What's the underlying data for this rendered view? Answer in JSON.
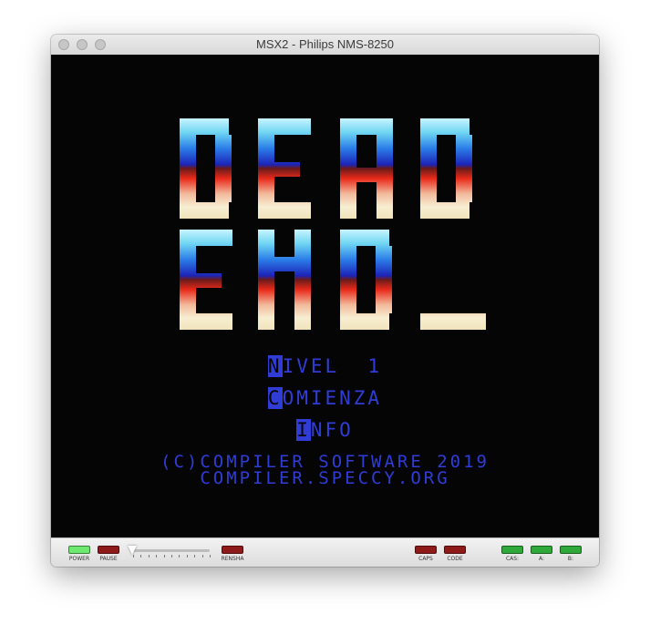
{
  "window": {
    "title": "MSX2 - Philips NMS-8250"
  },
  "game": {
    "logo_line1": "DEAD",
    "logo_line2": "END_",
    "menu": [
      {
        "initial": "N",
        "rest": "IVEL  1"
      },
      {
        "initial": "C",
        "rest": "OMIENZA"
      },
      {
        "initial": "I",
        "rest": "NFO"
      }
    ],
    "credits": [
      "(C)COMPILER SOFTWARE 2019",
      "COMPILER.SPECCY.ORG"
    ]
  },
  "statusbar": {
    "power": "POWER",
    "pause": "PAUSE",
    "rensha": "RENSHA",
    "caps": "CAPS",
    "code": "CODE",
    "cas": "CAS:",
    "a": "A:",
    "b": "B:",
    "rensha_level": 0
  },
  "colors": {
    "screen_bg": "#050505",
    "text_blue": "#2f3cd6",
    "led_green": "#2faa3a",
    "led_red": "#8e1a1a"
  }
}
